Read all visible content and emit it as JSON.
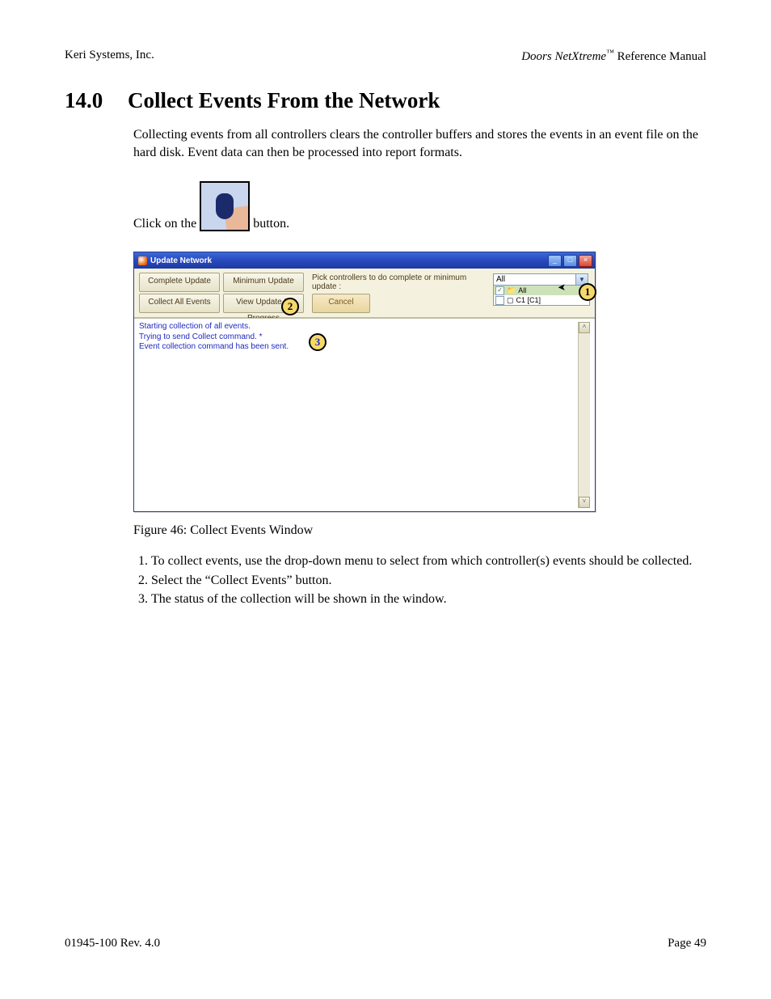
{
  "header": {
    "left": "Keri Systems, Inc.",
    "right_italic": "Doors NetXtreme",
    "right_tm": "™",
    "right_rest": " Reference Manual"
  },
  "section": {
    "number": "14.0",
    "title": "Collect Events From the Network",
    "intro": "Collecting events from all controllers clears the controller buffers and stores the events in an event file on the hard disk. Event data can then be processed into report formats."
  },
  "click_line": {
    "before": "Click on the",
    "after": " button."
  },
  "window": {
    "title": "Update Network",
    "buttons": {
      "complete": "Complete Update",
      "minimum": "Minimum Update",
      "collect": "Collect All Events",
      "view": "View Update In Progress",
      "cancel": "Cancel"
    },
    "pick_label": "Pick controllers to do complete or minimum update :",
    "dropdown": {
      "selected": "All",
      "row_all": "All",
      "row_ctrl": "C1 [C1]"
    },
    "log": {
      "l1": "Starting collection of all events.",
      "l2": "Trying to send Collect command. *",
      "l3": "Event collection command has been sent."
    },
    "callouts": {
      "c1": "1",
      "c2": "2",
      "c3": "3"
    }
  },
  "figure_caption": "Figure 46: Collect Events Window",
  "steps": {
    "s1": "To collect events, use the drop-down menu to select from which controller(s) events should be collected.",
    "s2": "Select the “Collect Events” button.",
    "s3": "The status of the collection will be shown in the window."
  },
  "footer": {
    "left": "01945-100  Rev. 4.0",
    "right": "Page 49"
  }
}
